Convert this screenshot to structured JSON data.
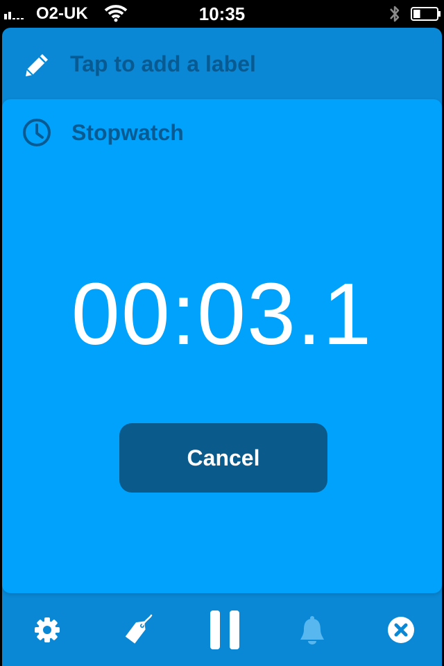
{
  "status_bar": {
    "carrier": "O2-UK",
    "time": "10:35",
    "battery_level": 0.3
  },
  "label_row": {
    "placeholder": "Tap to add a label"
  },
  "card": {
    "title": "Stopwatch",
    "elapsed": "00:03.1",
    "cancel_label": "Cancel"
  },
  "toolbar": {
    "icons": [
      "gear-icon",
      "tag-icon",
      "pause-icon",
      "bell-icon",
      "close-circle-icon"
    ]
  },
  "colors": {
    "app_background": "#0a88d6",
    "card_background": "#00a2fb",
    "text_dark_blue": "#075b92",
    "cancel_button": "#0a5a8c",
    "bell_muted": "#57b7ee"
  }
}
